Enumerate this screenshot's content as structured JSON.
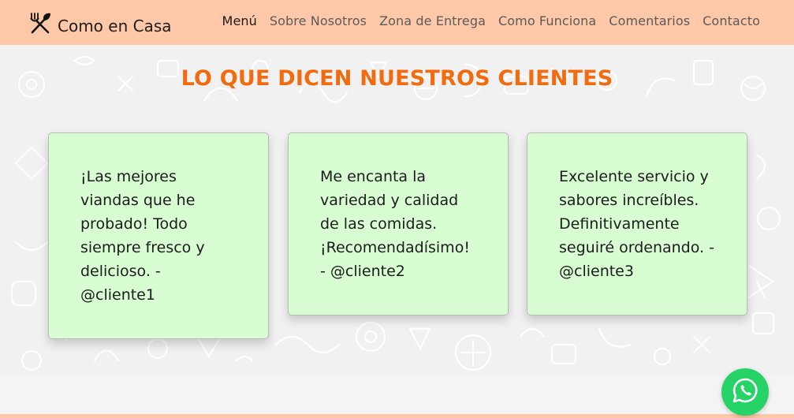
{
  "brand": {
    "name": "Como en Casa",
    "icon": "fork-knife-icon"
  },
  "nav": {
    "items": [
      {
        "label": "Menú",
        "active": true
      },
      {
        "label": "Sobre Nosotros",
        "active": false
      },
      {
        "label": "Zona de Entrega",
        "active": false
      },
      {
        "label": "Como Funciona",
        "active": false
      },
      {
        "label": "Comentarios",
        "active": false
      },
      {
        "label": "Contacto",
        "active": false
      }
    ]
  },
  "testimonials": {
    "title": "LO QUE DICEN NUESTROS CLIENTES",
    "cards": [
      {
        "text": "¡Las mejores viandas que he probado! Todo siempre fresco y delicioso. - @cliente1"
      },
      {
        "text": "Me encanta la variedad y calidad de las comidas. ¡Recomendadísimo! - @cliente2"
      },
      {
        "text": "Excelente servicio y sabores increíbles. Definitivamente seguiré ordenando. - @cliente3"
      }
    ]
  },
  "whatsapp": {
    "icon": "whatsapp-icon"
  },
  "colors": {
    "header_bg": "#ffc8a8",
    "title": "#f26c0f",
    "card_bg": "#d9fdd3",
    "whatsapp": "#25d366"
  }
}
